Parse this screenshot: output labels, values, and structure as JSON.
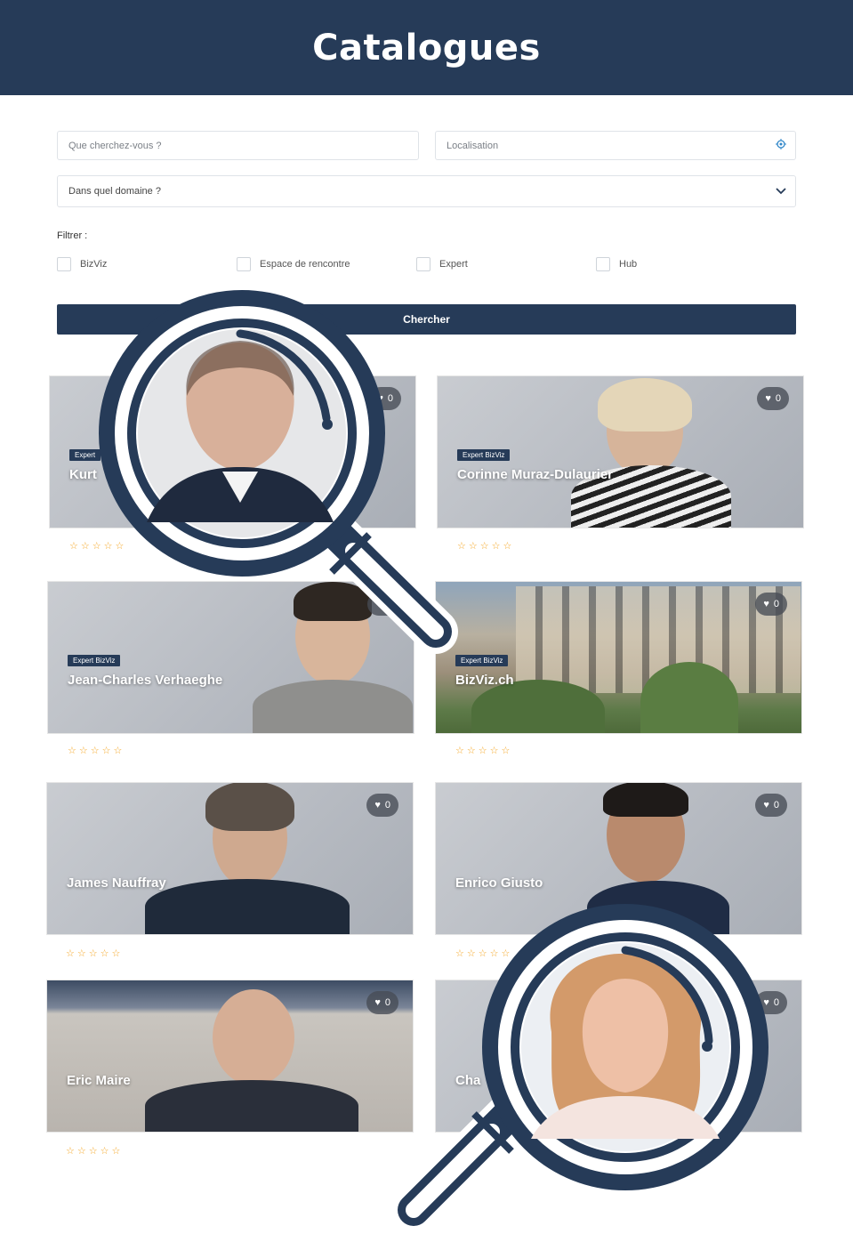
{
  "header": {
    "title": "Catalogues"
  },
  "search": {
    "query_placeholder": "Que cherchez-vous ?",
    "location_placeholder": "Localisation",
    "domain_placeholder": "Dans quel domaine ?"
  },
  "filters": {
    "label": "Filtrer :",
    "options": [
      "BizViz",
      "Espace de rencontre",
      "Expert",
      "Hub"
    ]
  },
  "search_button": {
    "label": "Chercher"
  },
  "cards": [
    {
      "name": "Kurt",
      "badge": "Expert",
      "likes": "0",
      "rating": "☆☆☆☆☆"
    },
    {
      "name": "Corinne Muraz-Dulaurier",
      "badge": "Expert BizViz",
      "likes": "0",
      "rating": "☆☆☆☆☆"
    },
    {
      "name": "Jean-Charles Verhaeghe",
      "badge": "Expert BizViz",
      "likes": "0",
      "rating": "☆☆☆☆☆"
    },
    {
      "name": "BizViz.ch",
      "badge": "Expert BizViz",
      "likes": "0",
      "rating": "☆☆☆☆☆"
    },
    {
      "name": "James Nauffray",
      "badge": "",
      "likes": "0",
      "rating": "☆☆☆☆☆"
    },
    {
      "name": "Enrico Giusto",
      "badge": "",
      "likes": "0",
      "rating": "☆☆☆☆☆"
    },
    {
      "name": "Eric Maire",
      "badge": "",
      "likes": "0",
      "rating": "☆☆☆☆☆"
    },
    {
      "name": "Cha",
      "badge": "",
      "likes": "0",
      "rating": ""
    }
  ],
  "colors": {
    "navy": "#263b58",
    "star": "#f5a623",
    "white": "#ffffff"
  },
  "icons": [
    "location-target-icon",
    "chevron-down-icon",
    "heart-icon",
    "star-icon",
    "magnifier-icon"
  ]
}
